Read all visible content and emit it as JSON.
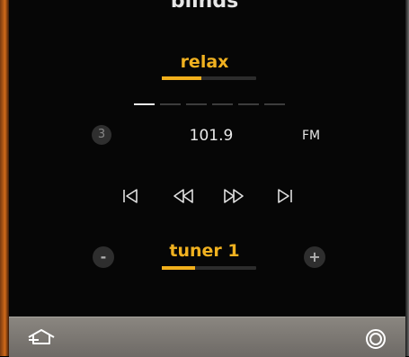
{
  "header": {
    "title": "blinds"
  },
  "zone": {
    "label": "relax",
    "level_fraction": 0.42
  },
  "tuner": {
    "preset_number": "3",
    "frequency": "101.9",
    "band": "FM",
    "preset_count": 6,
    "active_preset": 0
  },
  "transport": {
    "icons": [
      "skip-previous-icon",
      "rewind-icon",
      "fast-forward-icon",
      "skip-next-icon"
    ]
  },
  "source": {
    "label": "tuner 1",
    "minus_label": "-",
    "plus_label": "+",
    "level_fraction": 0.35
  },
  "bottom_bar": {
    "icons": [
      "home-icon",
      "power-icon"
    ]
  },
  "colors": {
    "accent": "#f0b120",
    "frame_orange": "#d06a1a",
    "bottom_bar": "#7c7873"
  }
}
